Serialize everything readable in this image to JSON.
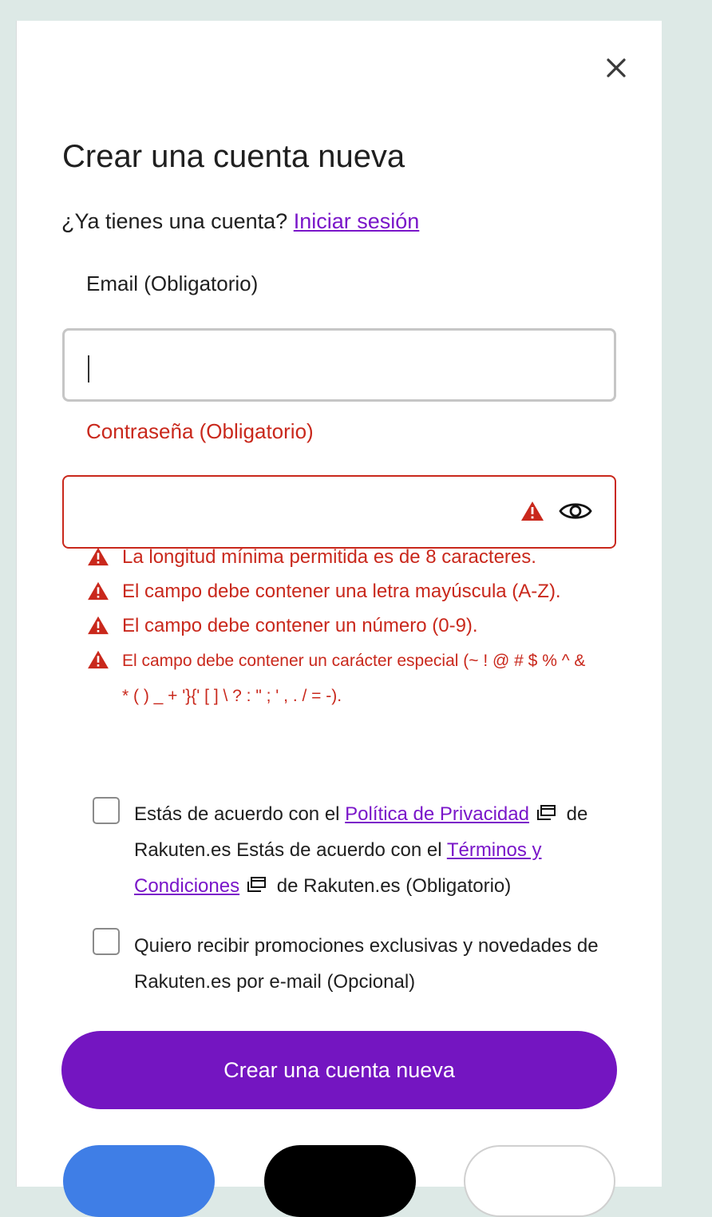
{
  "modal": {
    "close_label": "×",
    "title": "Crear una cuenta nueva",
    "signin_prompt": "¿Ya tienes una cuenta?",
    "signin_link": "Iniciar sesión"
  },
  "email": {
    "label": "Email (Obligatorio)",
    "value": ""
  },
  "password": {
    "label": "Contraseña (Obligatorio)",
    "value": ""
  },
  "errors": [
    "La longitud mínima permitida es de 8 caracteres.",
    "El campo debe contener una letra mayúscula (A-Z).",
    "El campo debe contener un número (0-9).",
    "El campo debe contener un carácter especial (~ ! @ # $ % ^ & * ( ) _ + '}{' [ ] \\ ? : \" ; ' , . / = -)."
  ],
  "consent": {
    "terms_prefix": "Estás de acuerdo con el",
    "privacy_link": "Política de Privacidad",
    "terms_middle": "de Rakuten.es Estás de acuerdo con el",
    "terms_link": "Términos y Condiciones",
    "terms_suffix": "de Rakuten.es (Obligatorio)",
    "promo_text": "Quiero recibir promociones exclusivas y novedades de Rakuten.es por e-mail (Opcional)"
  },
  "submit_label": "Crear una cuenta nueva",
  "colors": {
    "accent": "#7415c1",
    "error": "#c9281c",
    "background": "#dde9e6"
  },
  "icons": {
    "close": "close-icon",
    "warning": "warning-icon",
    "eye": "eye-icon",
    "external": "external-link-icon"
  }
}
